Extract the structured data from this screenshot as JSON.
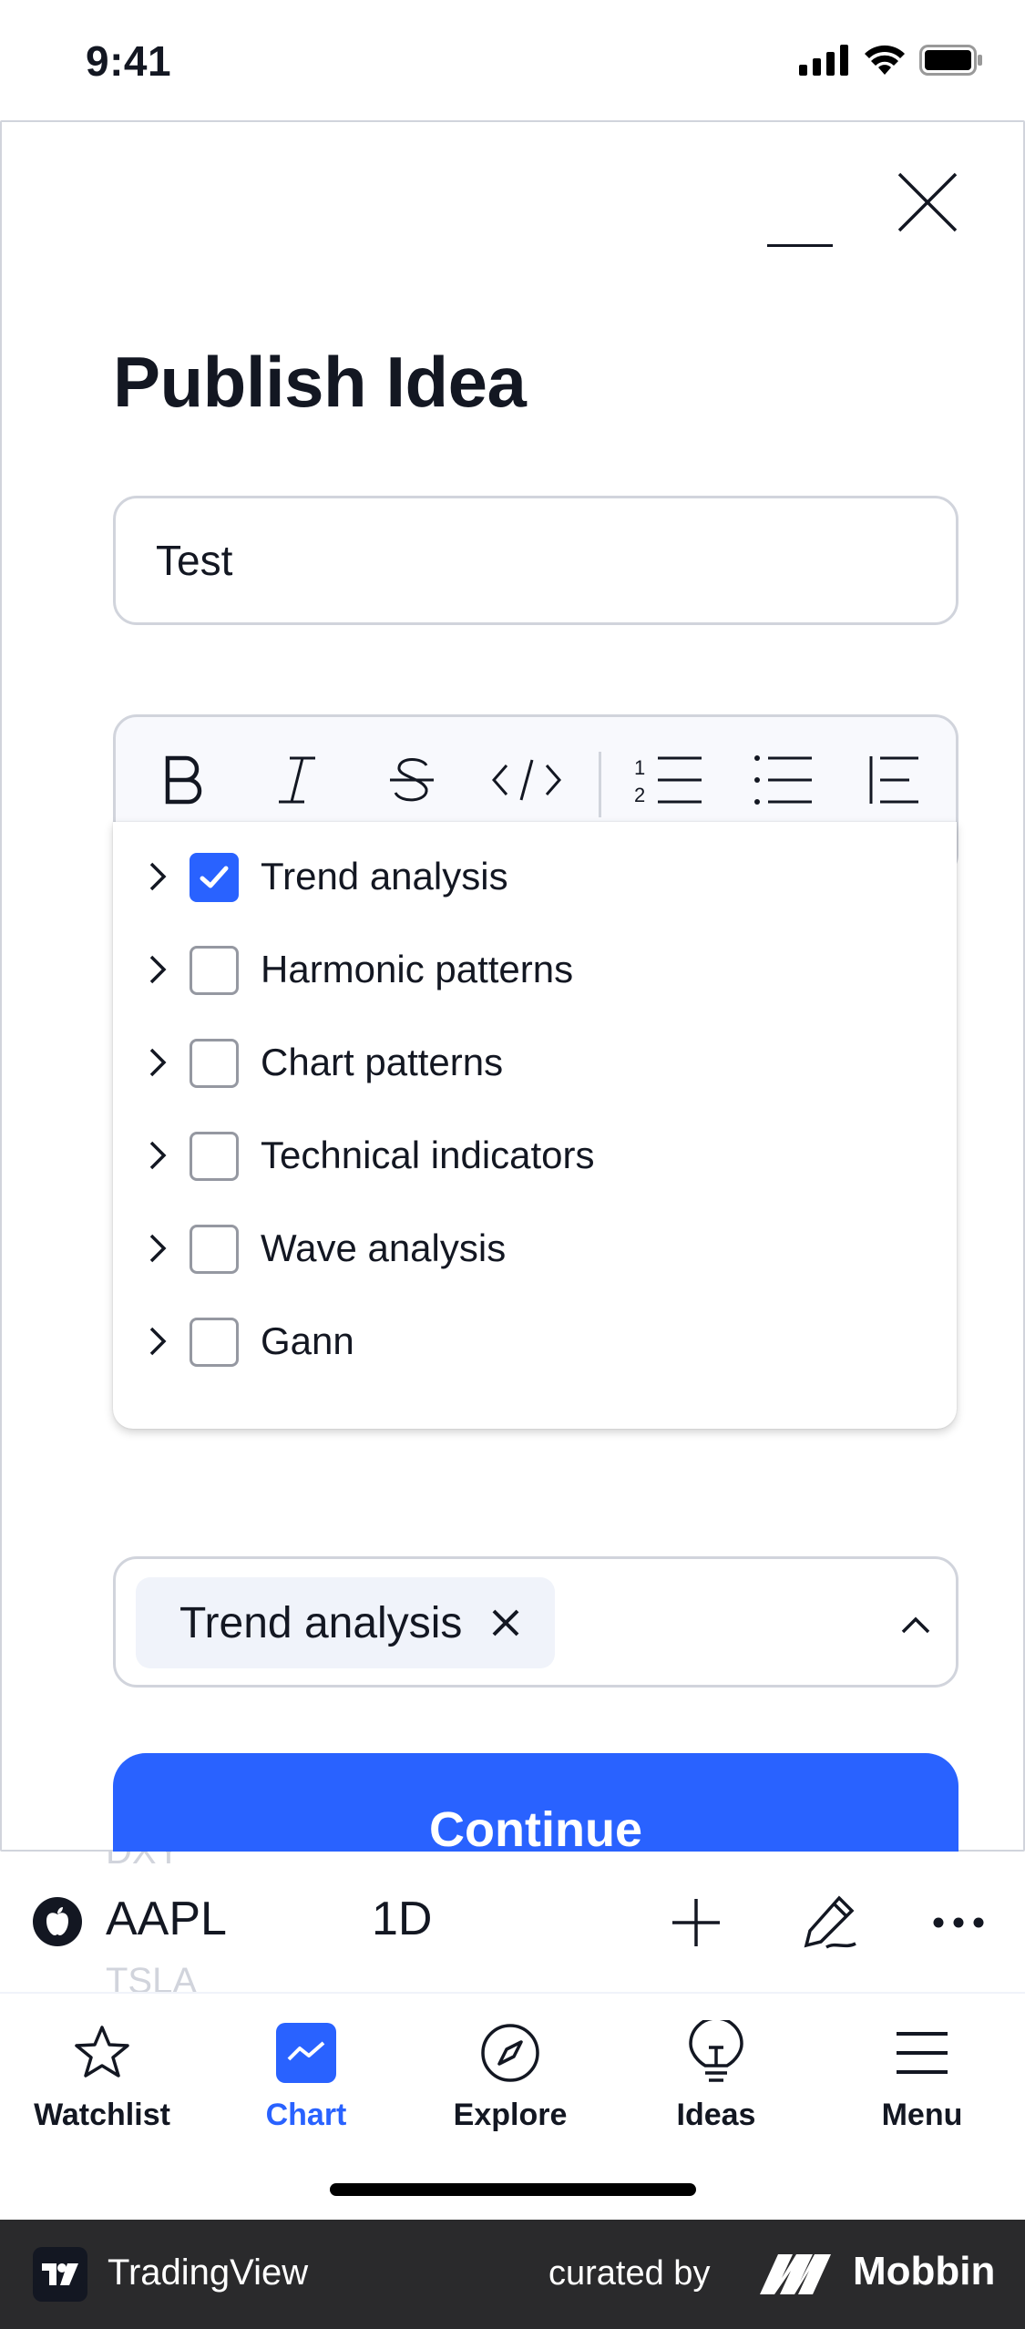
{
  "status_bar": {
    "time": "9:41"
  },
  "modal": {
    "title": "Publish Idea",
    "title_input_value": "Test",
    "continue_label": "Continue"
  },
  "editor_toolbar": {
    "tools": [
      "bold-icon",
      "italic-icon",
      "strikethrough-icon",
      "code-icon",
      "numbered-list-icon",
      "bulleted-list-icon",
      "indent-icon"
    ]
  },
  "dropdown": {
    "items": [
      {
        "label": "Trend analysis",
        "checked": true
      },
      {
        "label": "Harmonic patterns",
        "checked": false
      },
      {
        "label": "Chart patterns",
        "checked": false
      },
      {
        "label": "Technical indicators",
        "checked": false
      },
      {
        "label": "Wave analysis",
        "checked": false
      },
      {
        "label": "Gann",
        "checked": false
      }
    ]
  },
  "tag_select": {
    "selected": [
      "Trend analysis"
    ]
  },
  "chart_header": {
    "symbol": "AAPL",
    "interval": "1D",
    "ghost_prev": "DXY",
    "ghost_next": "TSLA"
  },
  "tabbar": {
    "items": [
      {
        "label": "Watchlist",
        "icon": "star-icon",
        "active": false
      },
      {
        "label": "Chart",
        "icon": "chart-icon",
        "active": true
      },
      {
        "label": "Explore",
        "icon": "compass-icon",
        "active": false
      },
      {
        "label": "Ideas",
        "icon": "lightbulb-icon",
        "active": false
      },
      {
        "label": "Menu",
        "icon": "hamburger-icon",
        "active": false
      }
    ]
  },
  "footer": {
    "app_name": "TradingView",
    "curated_by": "curated by",
    "brand": "Mobbin"
  },
  "colors": {
    "accent": "#2962ff",
    "text": "#131722",
    "border": "#d1d4dc",
    "chip_bg": "#f0f3fa",
    "footer_bg": "#2a2a2c"
  }
}
